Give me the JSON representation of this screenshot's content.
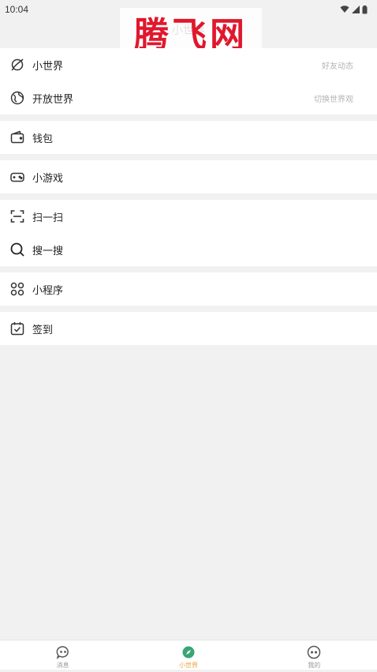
{
  "status_bar": {
    "time": "10:04"
  },
  "header": {
    "title": "小世界"
  },
  "watermark": {
    "text": "腾飞网"
  },
  "groups": [
    {
      "items": [
        {
          "label": "小世界",
          "hint": "好友动态",
          "icon": "planet-icon"
        },
        {
          "label": "开放世界",
          "hint": "切换世界观",
          "icon": "globe-icon"
        }
      ]
    },
    {
      "items": [
        {
          "label": "钱包",
          "icon": "wallet-icon"
        }
      ]
    },
    {
      "items": [
        {
          "label": "小游戏",
          "icon": "gamepad-icon"
        }
      ]
    },
    {
      "items": [
        {
          "label": "扫一扫",
          "icon": "scan-icon"
        },
        {
          "label": "搜一搜",
          "icon": "search-icon"
        }
      ]
    },
    {
      "items": [
        {
          "label": "小程序",
          "icon": "mini-program-icon"
        }
      ]
    },
    {
      "items": [
        {
          "label": "签到",
          "icon": "calendar-check-icon"
        }
      ]
    }
  ],
  "tabs": [
    {
      "label": "消息",
      "icon": "chat-icon",
      "active": false
    },
    {
      "label": "小世界",
      "icon": "compass-icon",
      "active": true
    },
    {
      "label": "我的",
      "icon": "profile-icon",
      "active": false
    }
  ],
  "colors": {
    "accent": "#e8a53c",
    "active_icon": "#3aa574",
    "watermark": "#e0182d",
    "background": "#f1f1f1"
  }
}
